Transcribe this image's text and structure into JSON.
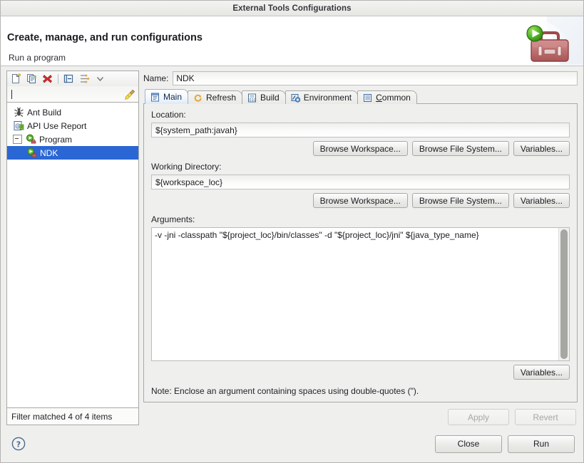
{
  "window": {
    "title": "External Tools Configurations"
  },
  "header": {
    "title": "Create, manage, and run configurations",
    "subtitle": "Run a program",
    "graphic": "toolbox-with-run-badge-icon"
  },
  "left_panel": {
    "toolbar": [
      {
        "name": "new-configuration-button",
        "icon": "new-document-icon"
      },
      {
        "name": "duplicate-configuration-button",
        "icon": "copy-icon"
      },
      {
        "name": "delete-configuration-button",
        "icon": "delete-red-x-icon"
      },
      {
        "name": "collapse-all-button",
        "icon": "collapse-all-icon"
      },
      {
        "name": "filter-button",
        "icon": "filter-icon"
      },
      {
        "name": "view-menu-button",
        "icon": "chevron-down-icon"
      }
    ],
    "filter": {
      "value": "",
      "placeholder": "",
      "clear_icon": "broom-clear-icon"
    },
    "tree": [
      {
        "label": "Ant Build",
        "icon": "ant-build-icon",
        "indent": 0,
        "selected": false,
        "expander": "none"
      },
      {
        "label": "API Use Report",
        "icon": "api-use-report-icon",
        "indent": 0,
        "selected": false,
        "expander": "none"
      },
      {
        "label": "Program",
        "icon": "program-icon",
        "indent": 0,
        "selected": false,
        "expander": "expanded"
      },
      {
        "label": "NDK",
        "icon": "program-icon",
        "indent": 1,
        "selected": true,
        "expander": "none"
      }
    ],
    "status": "Filter matched 4 of 4 items"
  },
  "config": {
    "name_label": "Name:",
    "name_value": "NDK",
    "tabs": [
      {
        "label": "Main",
        "icon": "main-tab-icon",
        "active": true,
        "mnemonic": ""
      },
      {
        "label": "Refresh",
        "icon": "refresh-tab-icon",
        "active": false,
        "mnemonic": ""
      },
      {
        "label": "Build",
        "icon": "build-tab-icon",
        "active": false,
        "mnemonic": ""
      },
      {
        "label": "Environment",
        "icon": "environment-tab-icon",
        "active": false,
        "mnemonic": ""
      },
      {
        "label": "Common",
        "icon": "common-tab-icon",
        "active": false,
        "mnemonic": "C"
      }
    ],
    "location": {
      "label": "Location:",
      "value": "${system_path:javah}",
      "buttons": [
        "Browse Workspace...",
        "Browse File System...",
        "Variables..."
      ]
    },
    "working_directory": {
      "label": "Working Directory:",
      "value": "${workspace_loc}",
      "buttons": [
        "Browse Workspace...",
        "Browse File System...",
        "Variables..."
      ]
    },
    "arguments": {
      "label": "Arguments:",
      "value": "-v -jni -classpath \"${project_loc}/bin/classes\" -d \"${project_loc}/jni\" ${java_type_name}",
      "variables_button": "Variables...",
      "note": "Note: Enclose an argument containing spaces using double-quotes (\")."
    },
    "apply_label": "Apply",
    "revert_label": "Revert",
    "apply_enabled": false,
    "revert_enabled": false
  },
  "footer": {
    "help_icon": "help-question-icon",
    "close_label": "Close",
    "run_label": "Run"
  },
  "colors": {
    "selection_blue": "#2a67d4",
    "dialog_bg": "#efefee",
    "field_bg": "#ffffff",
    "delete_red": "#cc2222",
    "run_green": "#43a01e",
    "toolbox_red": "#b05a5a"
  }
}
